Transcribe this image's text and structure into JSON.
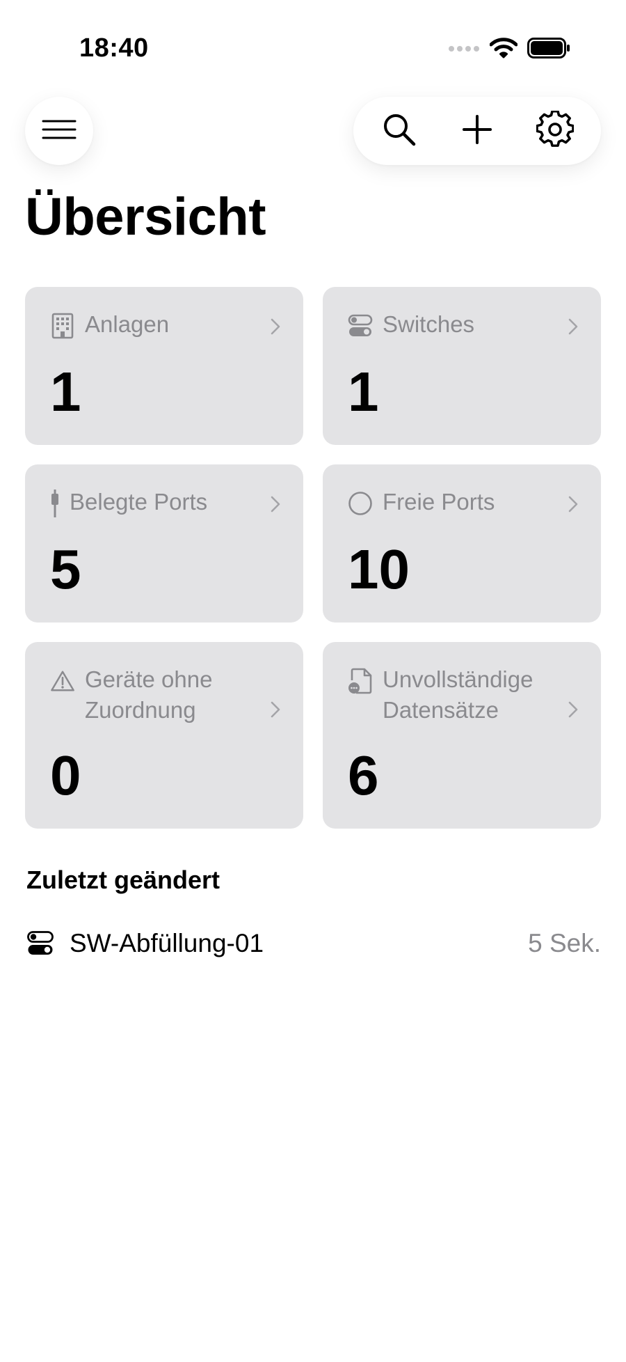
{
  "status_bar": {
    "time": "18:40"
  },
  "header": {
    "menu_icon": "hamburger-menu-icon",
    "actions": [
      {
        "icon": "search-icon"
      },
      {
        "icon": "plus-icon"
      },
      {
        "icon": "gear-icon"
      }
    ],
    "title": "Übersicht"
  },
  "cards": [
    {
      "label": "Anlagen",
      "value": "1",
      "icon": "building-icon"
    },
    {
      "label": "Switches",
      "value": "1",
      "icon": "switch-toggle-icon"
    },
    {
      "label": "Belegte Ports",
      "value": "5",
      "icon": "cable-plug-icon"
    },
    {
      "label": "Freie Ports",
      "value": "10",
      "icon": "empty-circle-icon"
    },
    {
      "label": "Geräte ohne Zuordnung",
      "value": "0",
      "icon": "warning-triangle-icon"
    },
    {
      "label": "Unvollständige Datensätze",
      "value": "6",
      "icon": "document-ellipsis-icon"
    }
  ],
  "recent": {
    "title": "Zuletzt geändert",
    "items": [
      {
        "name": "SW-Abfüllung-01",
        "time": "5 Sek.",
        "icon": "switch-toggle-icon"
      }
    ]
  },
  "colors": {
    "card_background": "#e3e3e5",
    "secondary_text": "#8a8a8e",
    "primary_text": "#000000",
    "background": "#ffffff"
  }
}
